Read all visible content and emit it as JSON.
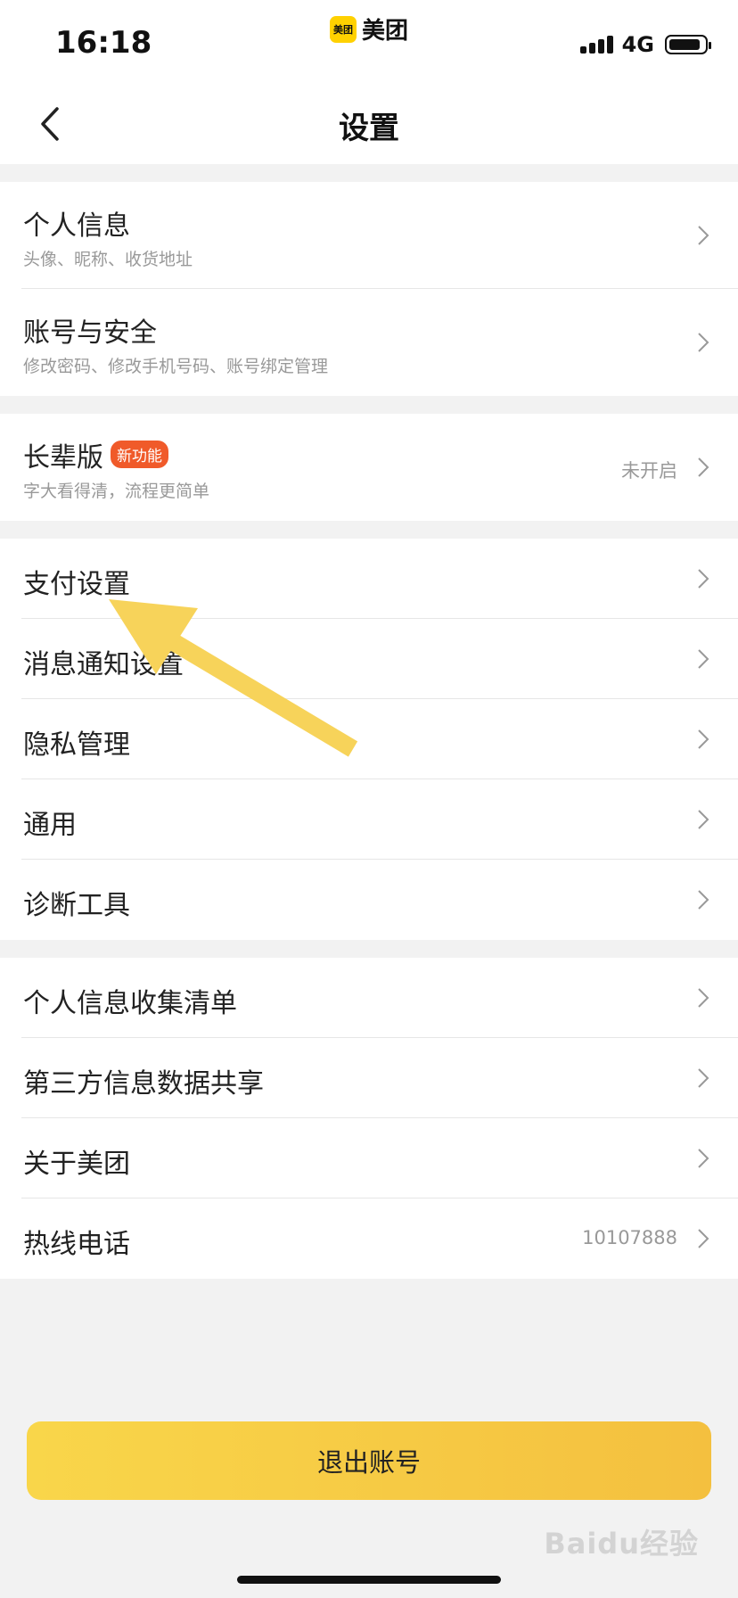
{
  "status_bar": {
    "time": "16:18",
    "app_name": "美团",
    "app_logo_text": "美团",
    "network": "4G"
  },
  "nav": {
    "title": "设置"
  },
  "groups": [
    {
      "items": [
        {
          "title": "个人信息",
          "subtitle": "头像、昵称、收货地址"
        },
        {
          "title": "账号与安全",
          "subtitle": "修改密码、修改手机号码、账号绑定管理"
        }
      ]
    },
    {
      "items": [
        {
          "title": "长辈版",
          "badge": "新功能",
          "subtitle": "字大看得清，流程更简单",
          "value": "未开启"
        }
      ]
    },
    {
      "items": [
        {
          "title": "支付设置"
        },
        {
          "title": "消息通知设置"
        },
        {
          "title": "隐私管理"
        },
        {
          "title": "通用"
        },
        {
          "title": "诊断工具"
        }
      ]
    },
    {
      "items": [
        {
          "title": "个人信息收集清单"
        },
        {
          "title": "第三方信息数据共享"
        },
        {
          "title": "关于美团"
        },
        {
          "title": "热线电话",
          "value": "10107888"
        }
      ]
    }
  ],
  "logout_label": "退出账号",
  "watermark": "Baidu经验",
  "colors": {
    "accent": "#f9d64a",
    "badge": "#f05a2a",
    "annotation_arrow": "#f7d35a"
  }
}
